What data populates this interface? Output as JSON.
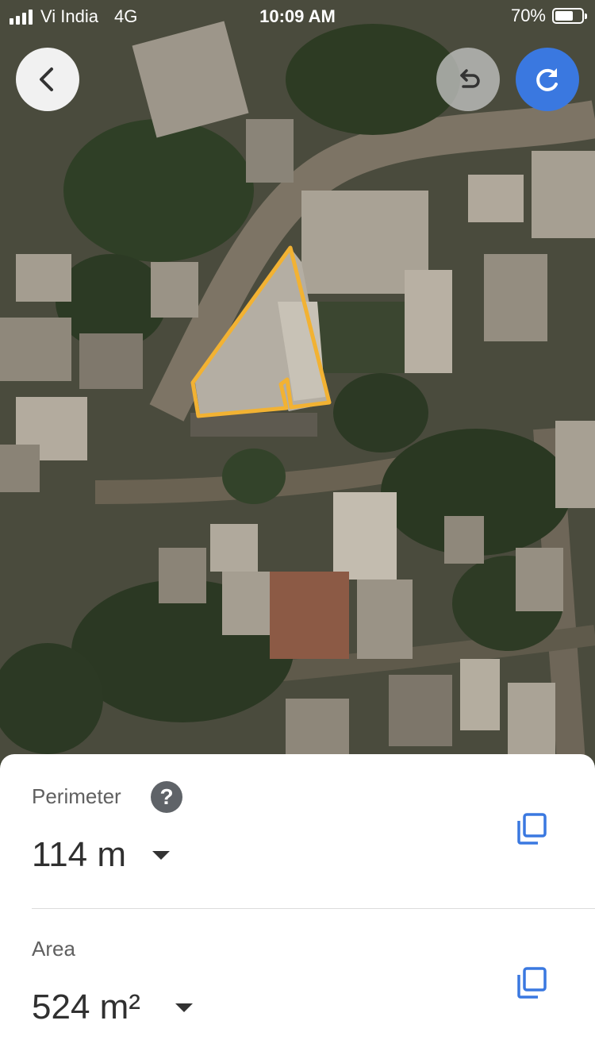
{
  "status_bar": {
    "carrier": "Vi India",
    "network": "4G",
    "time": "10:09 AM",
    "battery_percent": "70%",
    "battery_level": 0.7
  },
  "toolbar": {
    "back_icon": "chevron-left-icon",
    "undo_icon": "undo-icon",
    "redo_icon": "redo-icon",
    "accent_color": "#3a78e0"
  },
  "map": {
    "type": "satellite",
    "outline_color": "#f2b233"
  },
  "measurements": {
    "perimeter": {
      "label": "Perimeter",
      "value": "114 m",
      "help_icon": "question-mark-icon",
      "copy_icon": "copy-icon"
    },
    "area": {
      "label": "Area",
      "value": "524 m²",
      "copy_icon": "copy-icon"
    }
  }
}
